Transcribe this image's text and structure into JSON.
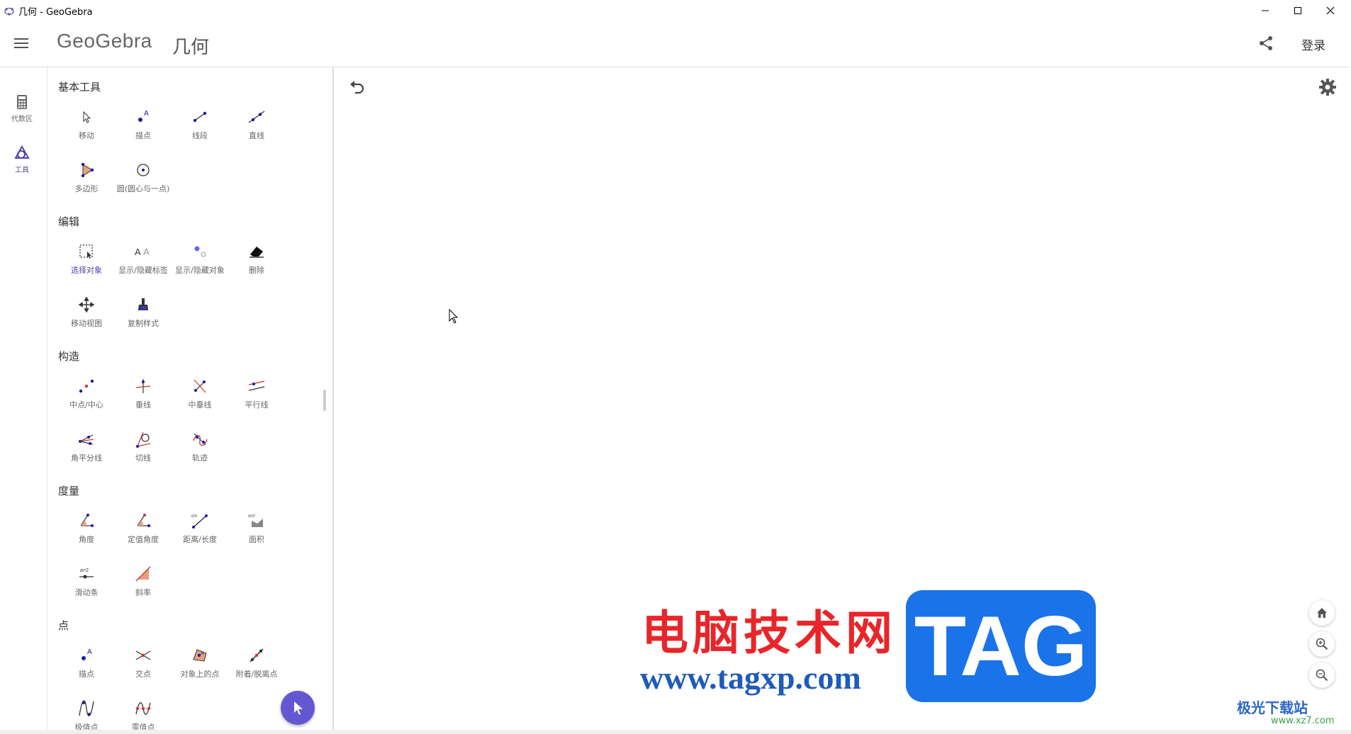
{
  "window": {
    "title": "几何 - GeoGebra"
  },
  "header": {
    "brand": "GeoGebra",
    "app_title": "几何",
    "login_label": "登录"
  },
  "rail": {
    "items": [
      {
        "label": "代数区",
        "icon": "calculator-icon"
      },
      {
        "label": "工具",
        "icon": "tools-icon",
        "active": true
      }
    ]
  },
  "sections": [
    {
      "title": "基本工具",
      "tools": [
        "移动",
        "描点",
        "线段",
        "直线",
        "多边形",
        "圆(圆心与一点)"
      ]
    },
    {
      "title": "编辑",
      "tools": [
        "选择对象",
        "显示/隐藏标签",
        "显示/隐藏对象",
        "删除",
        "移动视图",
        "复制样式"
      ]
    },
    {
      "title": "构造",
      "tools": [
        "中点/中心",
        "垂线",
        "中垂线",
        "平行线",
        "角平分线",
        "切线",
        "轨迹"
      ]
    },
    {
      "title": "度量",
      "tools": [
        "角度",
        "定值角度",
        "距离/长度",
        "面积",
        "滑动条",
        "斜率"
      ]
    },
    {
      "title": "点",
      "tools": [
        "描点",
        "交点",
        "对象上的点",
        "附着/脱离点",
        "极值点",
        "零值点"
      ]
    }
  ],
  "active_tool": "选择对象",
  "watermark": {
    "cn": "电脑技术网",
    "url": "www.tagxp.com",
    "tag": "TAG",
    "corner": "极光下载站",
    "corner_url": "www.xz7.com"
  },
  "colors": {
    "accent": "#6557d2",
    "tool_blue": "#1a1aa8",
    "tool_red": "#cc3333"
  }
}
